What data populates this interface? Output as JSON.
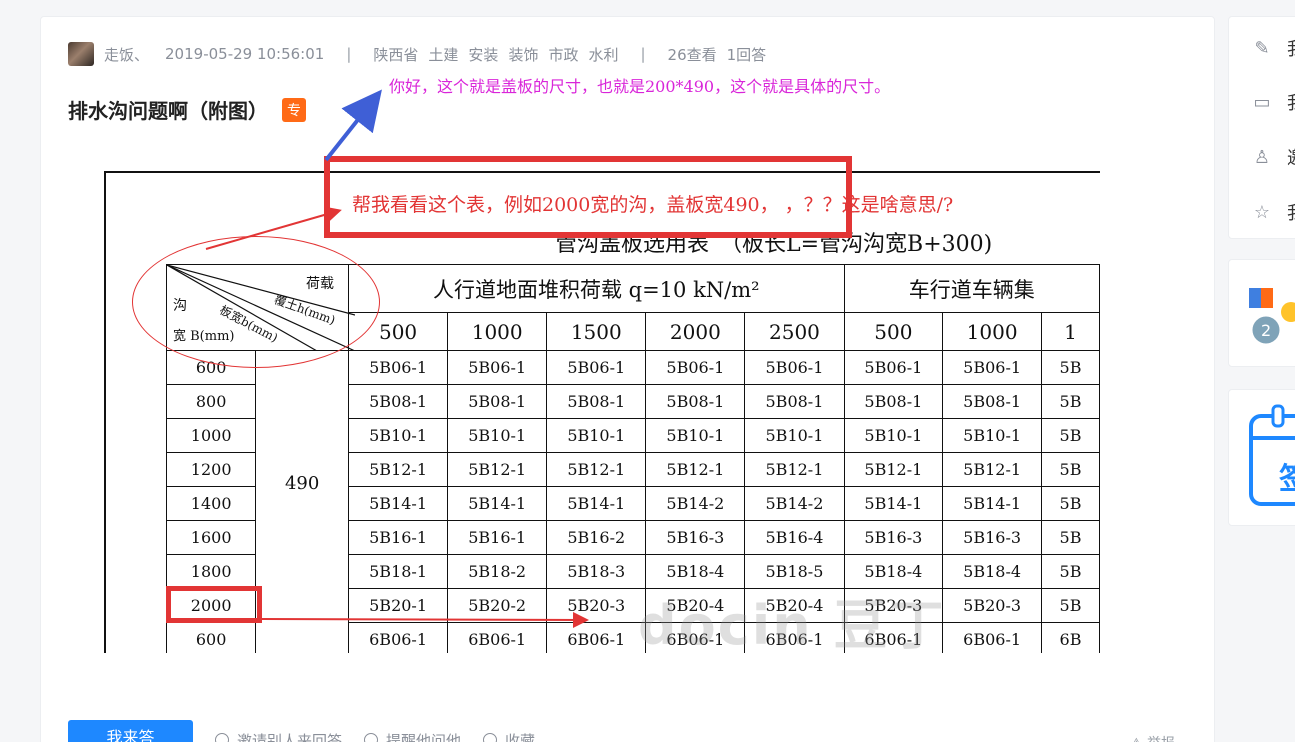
{
  "question": {
    "author": "走饭、",
    "datetime": "2019-05-29 10:56:01",
    "separator": "|",
    "region": "陕西省",
    "tags": [
      "土建",
      "安装",
      "装饰",
      "市政",
      "水利"
    ],
    "views": "26查看",
    "answers": "1回答",
    "title": "排水沟问题啊（附图）",
    "badge": "专"
  },
  "annotations": {
    "top": "你好，这个就是盖板的尺寸，也就是200*490，这个就是具体的尺寸。",
    "question": "帮我看看这个表，例如2000宽的沟，盖板宽490，    ，？？这是啥意思/?"
  },
  "document": {
    "title": "管沟盖板选用表　（板长L=管沟沟宽B+300)",
    "diag_labels": {
      "load": "荷载",
      "cover": "覆土h(mm)",
      "plate_width": "板宽b(mm)",
      "ditch": "沟",
      "ditch_width": "宽 B(mm)"
    },
    "group_headers": [
      "人行道地面堆积荷载 q=10 kN/m²",
      "车行道车辆集"
    ],
    "depths": [
      "500",
      "1000",
      "1500",
      "2000",
      "2500",
      "500",
      "1000",
      "1"
    ],
    "plate_width": "490",
    "rows": [
      {
        "width": "600",
        "cells": [
          "5B06-1",
          "5B06-1",
          "5B06-1",
          "5B06-1",
          "5B06-1",
          "5B06-1",
          "5B06-1",
          "5B"
        ]
      },
      {
        "width": "800",
        "cells": [
          "5B08-1",
          "5B08-1",
          "5B08-1",
          "5B08-1",
          "5B08-1",
          "5B08-1",
          "5B08-1",
          "5B"
        ]
      },
      {
        "width": "1000",
        "cells": [
          "5B10-1",
          "5B10-1",
          "5B10-1",
          "5B10-1",
          "5B10-1",
          "5B10-1",
          "5B10-1",
          "5B"
        ]
      },
      {
        "width": "1200",
        "cells": [
          "5B12-1",
          "5B12-1",
          "5B12-1",
          "5B12-1",
          "5B12-1",
          "5B12-1",
          "5B12-1",
          "5B"
        ]
      },
      {
        "width": "1400",
        "cells": [
          "5B14-1",
          "5B14-1",
          "5B14-1",
          "5B14-2",
          "5B14-2",
          "5B14-1",
          "5B14-1",
          "5B"
        ]
      },
      {
        "width": "1600",
        "cells": [
          "5B16-1",
          "5B16-1",
          "5B16-2",
          "5B16-3",
          "5B16-4",
          "5B16-3",
          "5B16-3",
          "5B"
        ]
      },
      {
        "width": "1800",
        "cells": [
          "5B18-1",
          "5B18-2",
          "5B18-3",
          "5B18-4",
          "5B18-5",
          "5B18-4",
          "5B18-4",
          "5B"
        ]
      },
      {
        "width": "2000",
        "cells": [
          "5B20-1",
          "5B20-2",
          "5B20-3",
          "5B20-4",
          "5B20-4",
          "5B20-3",
          "5B20-3",
          "5B"
        ]
      },
      {
        "width": "600",
        "cells": [
          "6B06-1",
          "6B06-1",
          "6B06-1",
          "6B06-1",
          "6B06-1",
          "6B06-1",
          "6B06-1",
          "6B"
        ]
      }
    ],
    "watermark": "docin 豆丁"
  },
  "actions": {
    "answer": "我来答",
    "invite": "邀请别人来回答",
    "remind": "提醒他问他",
    "favorite": "收藏",
    "report": "举报"
  },
  "sidebar": {
    "items": [
      {
        "icon": "edit-icon",
        "label": "我"
      },
      {
        "icon": "comment-icon",
        "label": "我"
      },
      {
        "icon": "user-add-icon",
        "label": "邀"
      },
      {
        "icon": "star-icon",
        "label": "我"
      }
    ],
    "checkin": "签"
  },
  "colors": {
    "annotation_red": "#e23535",
    "annotation_magenta": "#d925d9",
    "arrow_blue": "#3f5fd6",
    "primary": "#1e88ff",
    "badge": "#ff6a16"
  }
}
